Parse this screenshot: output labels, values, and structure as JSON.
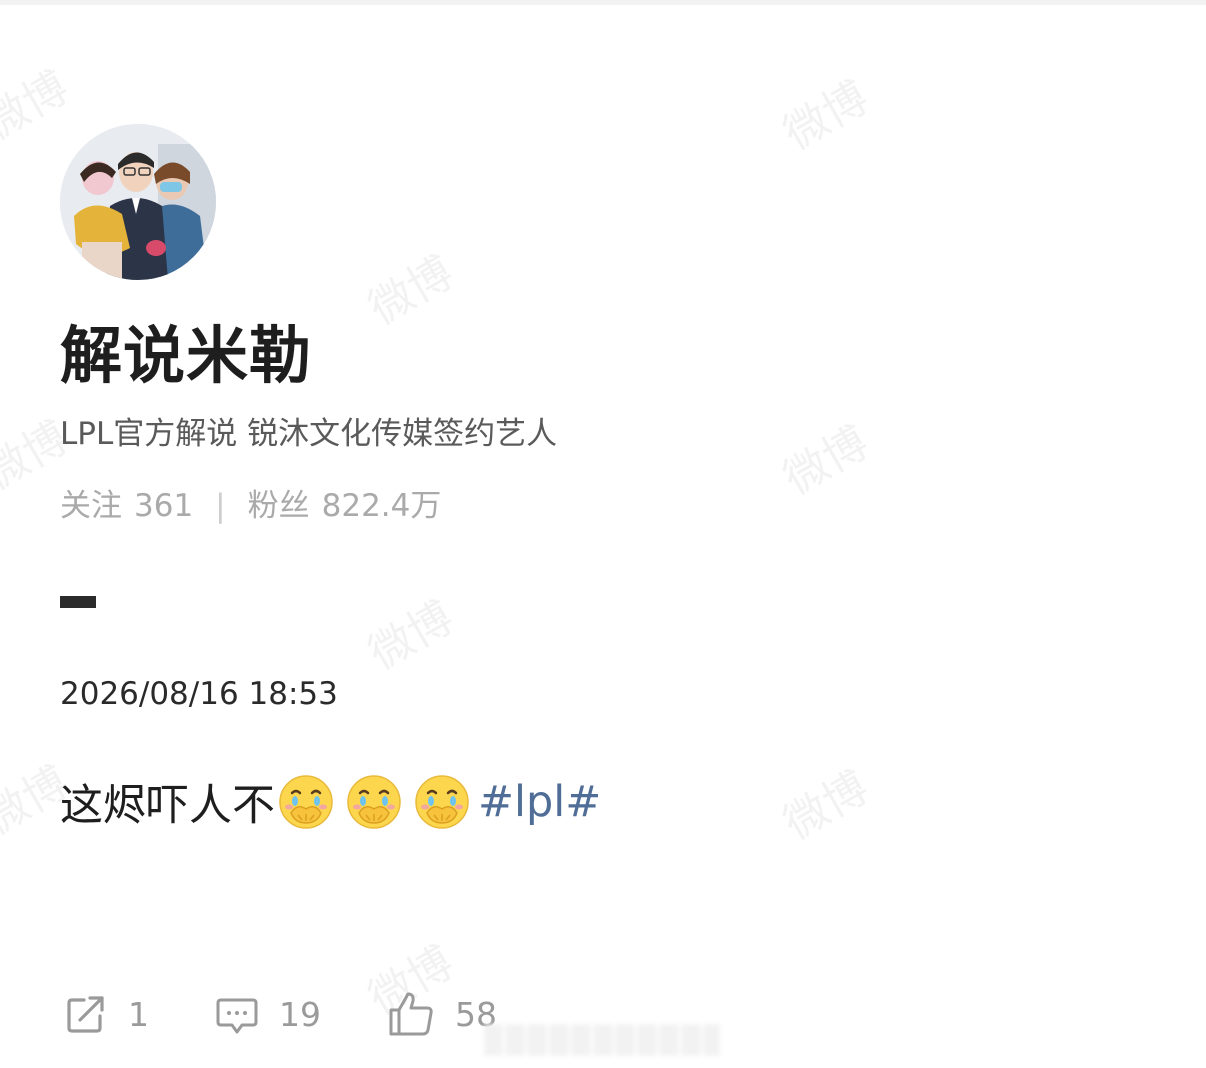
{
  "watermark": {
    "text": "微博"
  },
  "profile": {
    "avatar_icon": "profile-photo-avatar",
    "name": "解说米勒",
    "bio": "LPL官方解说 锐沐文化传媒签约艺人",
    "following_label": "关注",
    "following_count": "361",
    "separator": "|",
    "followers_label": "粉丝",
    "followers_count": "822.4万"
  },
  "post": {
    "timestamp": "2026/08/16 18:53",
    "text": "这烬吓人不",
    "emoji_icon": "cover-mouth-crying-emoji",
    "emoji_count": 3,
    "topic": "#lpl#"
  },
  "actions": {
    "repost": {
      "icon": "repost-icon",
      "count": "1"
    },
    "comment": {
      "icon": "comment-icon",
      "count": "19"
    },
    "like": {
      "icon": "thumbs-up-icon",
      "count": "58"
    }
  },
  "colors": {
    "topic": "#4f6d96",
    "secondary_text": "#aaaaaa",
    "bio_text": "#5a5a5a",
    "icon_gray": "#9a9a9a"
  }
}
